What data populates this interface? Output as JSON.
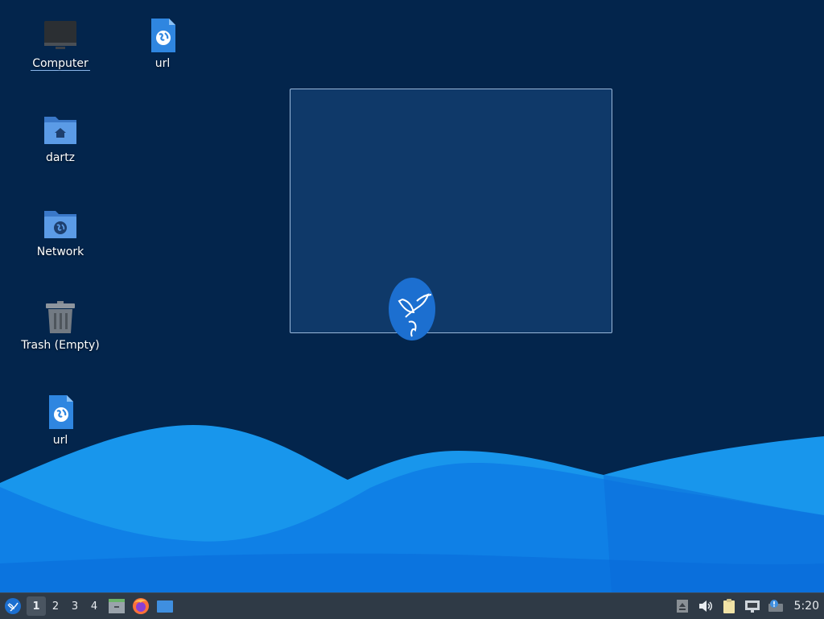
{
  "desktop": {
    "icons": [
      {
        "label": "Computer",
        "icon": "computer-icon",
        "selected": true
      },
      {
        "label": "url",
        "icon": "web-file-icon"
      },
      {
        "label": "dartz",
        "icon": "home-folder-icon"
      },
      {
        "label": "Network",
        "icon": "network-folder-icon"
      },
      {
        "label": "Trash (Empty)",
        "icon": "trash-icon"
      },
      {
        "label": "url",
        "icon": "web-file-icon"
      }
    ]
  },
  "taskbar": {
    "start_icon": "menu-bird-icon",
    "workspaces": [
      "1",
      "2",
      "3",
      "4"
    ],
    "active_workspace": "1",
    "launchers": [
      "file-manager-icon",
      "firefox-icon",
      "show-desktop-icon"
    ],
    "tray": [
      "eject-icon",
      "volume-icon",
      "clipboard-icon",
      "network-icon",
      "update-notifier-icon"
    ],
    "clock": "5:20"
  },
  "colors": {
    "background": "#03254c",
    "wave_light": "#1a9ff0",
    "wave_mid": "#0e7de6",
    "wave_dark": "#0a66d8",
    "taskbar": "#2f3a46",
    "selection": "#3c82d2"
  }
}
